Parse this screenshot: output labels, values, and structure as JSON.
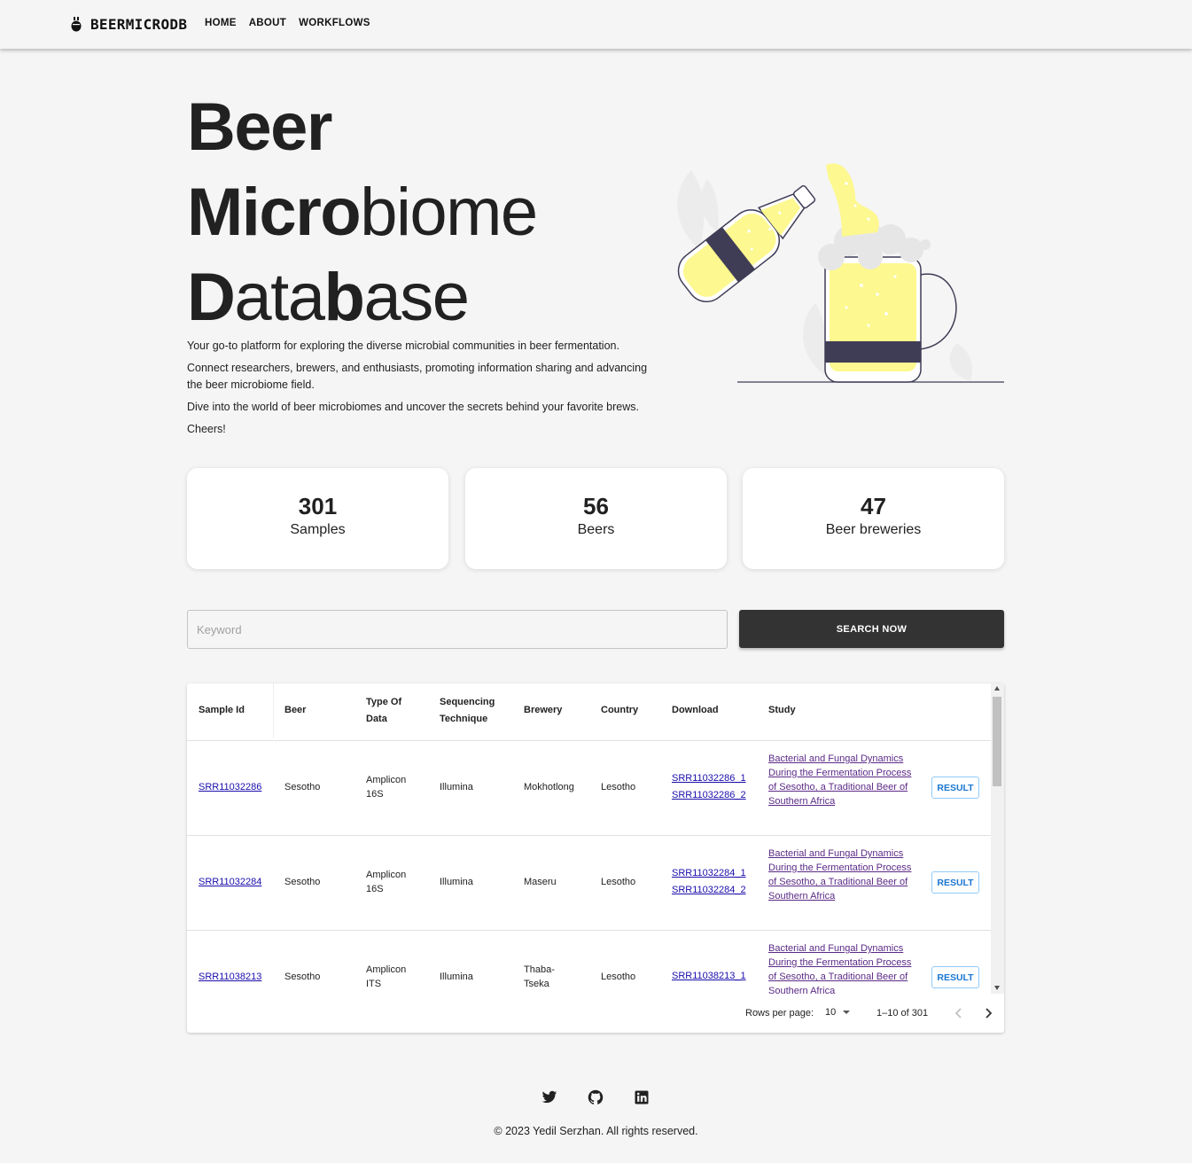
{
  "nav": {
    "brand": "BEERMICRODB",
    "links": [
      "HOME",
      "ABOUT",
      "WORKFLOWS"
    ]
  },
  "hero": {
    "title_line1": "Beer",
    "title_line2_bold": "Micro",
    "title_line2_light": "biome",
    "title_line3_bold1": "D",
    "title_line3_light1": "ata",
    "title_line3_bold2": "b",
    "title_line3_light2": "ase",
    "paragraphs": [
      "Your go-to platform for exploring the diverse microbial communities in beer fermentation.",
      "Connect researchers, brewers, and enthusiasts, promoting information sharing and advancing the beer microbiome field.",
      "Dive into the world of beer microbiomes and uncover the secrets behind your favorite brews.",
      "Cheers!"
    ]
  },
  "stats": [
    {
      "value": "301",
      "label": "Samples"
    },
    {
      "value": "56",
      "label": "Beers"
    },
    {
      "value": "47",
      "label": "Beer breweries"
    }
  ],
  "search": {
    "placeholder": "Keyword",
    "value": "",
    "button": "SEARCH NOW"
  },
  "table": {
    "headers": {
      "sample_id": "Sample Id",
      "beer": "Beer",
      "type_line1": "Type Of",
      "type_line2": "Data",
      "seq_line1": "Sequencing",
      "seq_line2": "Technique",
      "brewery": "Brewery",
      "country": "Country",
      "download": "Download",
      "study": "Study"
    },
    "rows": [
      {
        "sample_id": "SRR11032286",
        "beer": "Sesotho",
        "type_line1": "Amplicon",
        "type_line2": "16S",
        "technique": "Illumina",
        "brewery_line1": "Mokhotlong",
        "brewery_line2": "",
        "country": "Lesotho",
        "download1": "SRR11032286_1",
        "download2": "SRR11032286_2",
        "study": "Bacterial and Fungal Dynamics During the Fermentation Process of Sesotho, a Traditional Beer of Southern Africa",
        "action": "RESULT"
      },
      {
        "sample_id": "SRR11032284",
        "beer": "Sesotho",
        "type_line1": "Amplicon",
        "type_line2": "16S",
        "technique": "Illumina",
        "brewery_line1": "Maseru",
        "brewery_line2": "",
        "country": "Lesotho",
        "download1": "SRR11032284_1",
        "download2": "SRR11032284_2",
        "study": "Bacterial and Fungal Dynamics During the Fermentation Process of Sesotho, a Traditional Beer of Southern Africa",
        "action": "RESULT"
      },
      {
        "sample_id": "SRR11038213",
        "beer": "Sesotho",
        "type_line1": "Amplicon",
        "type_line2": "ITS",
        "technique": "Illumina",
        "brewery_line1": "Thaba-",
        "brewery_line2": "Tseka",
        "country": "Lesotho",
        "download1": "SRR11038213_1",
        "download2": "",
        "study": "Bacterial and Fungal Dynamics During the Fermentation Process of Sesotho, a Traditional Beer of Southern Africa",
        "action": "RESULT"
      }
    ],
    "pagination": {
      "rows_per_page_label": "Rows per page:",
      "rows_per_page": "10",
      "range": "1–10 of 301"
    }
  },
  "footer": {
    "icons": [
      "twitter-icon",
      "github-icon",
      "linkedin-icon"
    ],
    "copyright": "© 2023 Yedil Serzhan. All rights reserved."
  },
  "colors": {
    "beer_yellow": "#fdf88f",
    "label_dark": "#3f3d56",
    "button_dark": "#333333",
    "result_blue": "#1976d2",
    "link_blue": "#1a0dab",
    "study_purple": "#5b2a86"
  }
}
